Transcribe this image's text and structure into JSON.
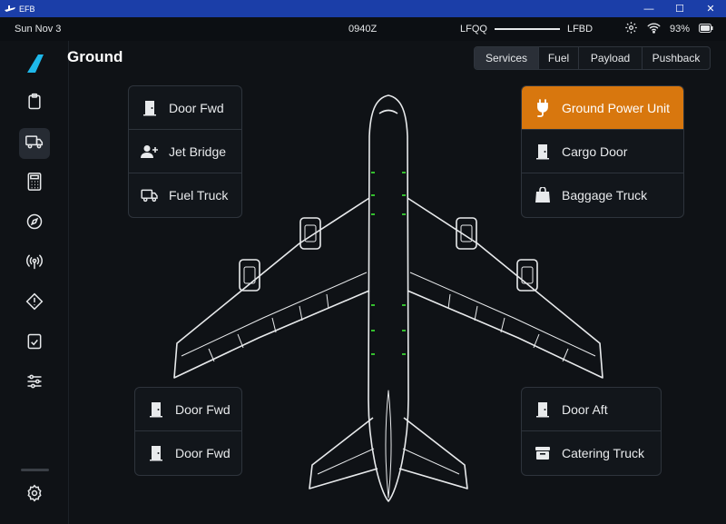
{
  "window": {
    "title": "EFB",
    "minimize": "—",
    "maximize": "☐",
    "close": "✕"
  },
  "status": {
    "date": "Sun Nov 3",
    "utc": "0940Z",
    "origin": "LFQQ",
    "destination": "LFBD",
    "battery": "93%"
  },
  "page": {
    "title": "Ground"
  },
  "tabs": [
    {
      "label": "Services"
    },
    {
      "label": "Fuel"
    },
    {
      "label": "Payload"
    },
    {
      "label": "Pushback"
    }
  ],
  "panels": {
    "top_left": [
      {
        "label": "Door Fwd",
        "icon": "door-icon"
      },
      {
        "label": "Jet Bridge",
        "icon": "person-add-icon"
      },
      {
        "label": "Fuel Truck",
        "icon": "truck-icon"
      }
    ],
    "top_right": [
      {
        "label": "Ground Power Unit",
        "icon": "plug-icon"
      },
      {
        "label": "Cargo Door",
        "icon": "door-icon"
      },
      {
        "label": "Baggage Truck",
        "icon": "bag-icon"
      }
    ],
    "bottom_left": [
      {
        "label": "Door Fwd",
        "icon": "door-icon"
      },
      {
        "label": "Door Fwd",
        "icon": "door-icon"
      }
    ],
    "bottom_right": [
      {
        "label": "Door Aft",
        "icon": "door-icon"
      },
      {
        "label": "Catering Truck",
        "icon": "catering-box-icon"
      }
    ]
  },
  "sidebar": [
    "logo-icon",
    "clipboard-icon",
    "truck-icon",
    "calculator-icon",
    "compass-icon",
    "broadcast-icon",
    "warning-icon",
    "checklist-icon",
    "sliders-icon",
    "settings-icon"
  ],
  "colors": {
    "accent": "#d8770e",
    "background": "#0f1216",
    "titlebar": "#1b3ea8",
    "logo": "#1eb8ea",
    "door_marker": "#34c02e"
  }
}
